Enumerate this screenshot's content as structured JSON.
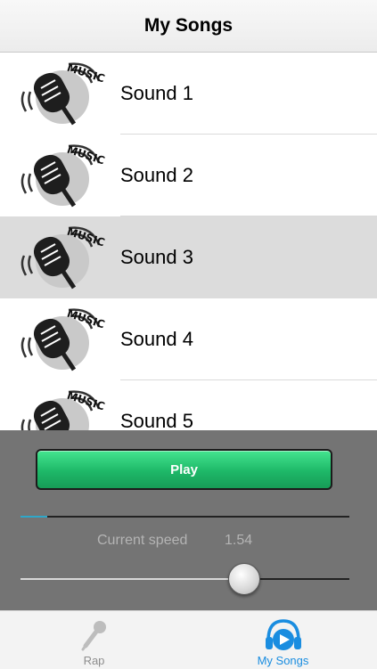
{
  "nav": {
    "title": "My Songs"
  },
  "songs": [
    {
      "label": "Sound 1",
      "selected": false
    },
    {
      "label": "Sound 2",
      "selected": false
    },
    {
      "label": "Sound 3",
      "selected": true
    },
    {
      "label": "Sound 4",
      "selected": false
    },
    {
      "label": "Sound 5",
      "selected": false
    }
  ],
  "thumb_text": "MUSIC",
  "player": {
    "play_label": "Play",
    "progress_fraction": 0.08,
    "speed_label": "Current speed",
    "speed_value": "1.54",
    "speed_fraction": 0.68,
    "accent_color": "#2ea7c9"
  },
  "tabs": [
    {
      "label": "Rap",
      "icon": "microphone-icon",
      "active": false
    },
    {
      "label": "My Songs",
      "icon": "play-headphones-icon",
      "active": true
    }
  ],
  "colors": {
    "play_green": "#1eb868",
    "tab_active": "#1a8de0",
    "panel_bg": "#747474"
  }
}
